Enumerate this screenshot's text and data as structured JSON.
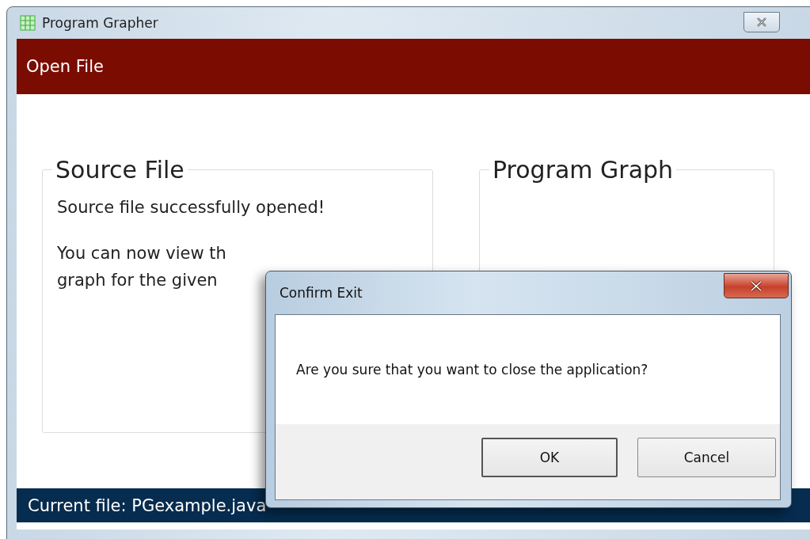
{
  "window": {
    "title": "Program Grapher"
  },
  "header": {
    "title": "Open File"
  },
  "groups": [
    {
      "title": "Source File",
      "lines": [
        "Source file successfully opened!",
        "You can now view th",
        "graph for the given"
      ]
    },
    {
      "title": "Program Graph"
    }
  ],
  "status_bar": {
    "text": "Current file: PGexample.java"
  },
  "dialog": {
    "title": "Confirm Exit",
    "message": "Are you sure that you want to close the application?",
    "buttons": [
      {
        "label": "OK",
        "selected": true
      },
      {
        "label": "Cancel",
        "selected": false
      }
    ]
  }
}
